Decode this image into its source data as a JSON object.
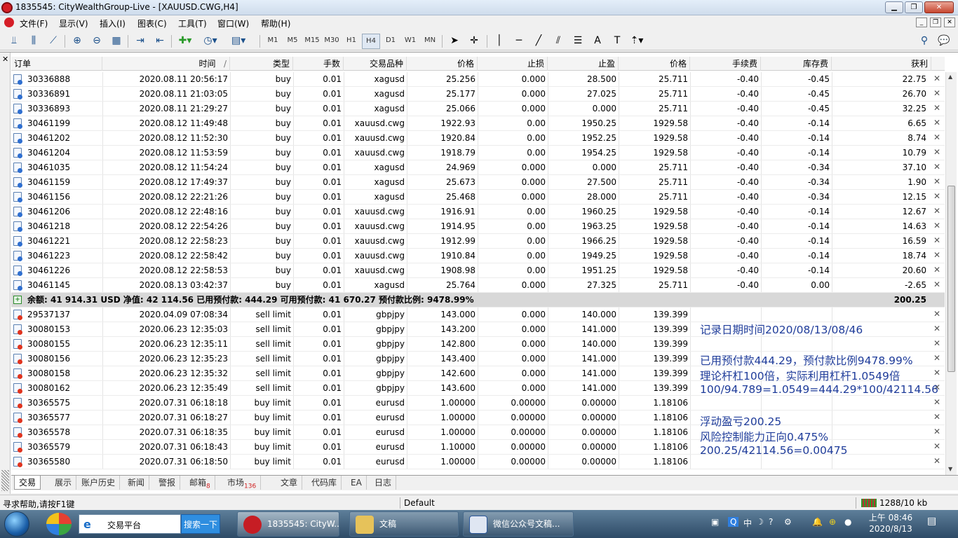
{
  "window": {
    "title": "1835545: CityWealthGroup-Live - [XAUUSD.CWG,H4]"
  },
  "menu": [
    "文件(F)",
    "显示(V)",
    "插入(I)",
    "图表(C)",
    "工具(T)",
    "窗口(W)",
    "帮助(H)"
  ],
  "timeframes": [
    {
      "label": "M1",
      "active": false
    },
    {
      "label": "M5",
      "active": false
    },
    {
      "label": "M15",
      "active": false
    },
    {
      "label": "M30",
      "active": false
    },
    {
      "label": "H1",
      "active": false
    },
    {
      "label": "H4",
      "active": true
    },
    {
      "label": "D1",
      "active": false
    },
    {
      "label": "W1",
      "active": false
    },
    {
      "label": "MN",
      "active": false
    }
  ],
  "columns": {
    "order": "订单",
    "time": "时间",
    "type": "类型",
    "lots": "手数",
    "symbol": "交易品种",
    "price": "价格",
    "sl": "止损",
    "tp": "止盈",
    "cur_price": "价格",
    "commission": "手续费",
    "swap": "库存费",
    "profit": "获利",
    "sort_marker": "/"
  },
  "open_positions": [
    [
      "30336888",
      "2020.08.11 20:56:17",
      "buy",
      "0.01",
      "xagusd",
      "25.256",
      "0.000",
      "28.500",
      "25.711",
      "-0.40",
      "-0.45",
      "22.75"
    ],
    [
      "30336891",
      "2020.08.11 21:03:05",
      "buy",
      "0.01",
      "xagusd",
      "25.177",
      "0.000",
      "27.025",
      "25.711",
      "-0.40",
      "-0.45",
      "26.70"
    ],
    [
      "30336893",
      "2020.08.11 21:29:27",
      "buy",
      "0.01",
      "xagusd",
      "25.066",
      "0.000",
      "0.000",
      "25.711",
      "-0.40",
      "-0.45",
      "32.25"
    ],
    [
      "30461199",
      "2020.08.12 11:49:48",
      "buy",
      "0.01",
      "xauusd.cwg",
      "1922.93",
      "0.00",
      "1950.25",
      "1929.58",
      "-0.40",
      "-0.14",
      "6.65"
    ],
    [
      "30461202",
      "2020.08.12 11:52:30",
      "buy",
      "0.01",
      "xauusd.cwg",
      "1920.84",
      "0.00",
      "1952.25",
      "1929.58",
      "-0.40",
      "-0.14",
      "8.74"
    ],
    [
      "30461204",
      "2020.08.12 11:53:59",
      "buy",
      "0.01",
      "xauusd.cwg",
      "1918.79",
      "0.00",
      "1954.25",
      "1929.58",
      "-0.40",
      "-0.14",
      "10.79"
    ],
    [
      "30461035",
      "2020.08.12 11:54:24",
      "buy",
      "0.01",
      "xagusd",
      "24.969",
      "0.000",
      "0.000",
      "25.711",
      "-0.40",
      "-0.34",
      "37.10"
    ],
    [
      "30461159",
      "2020.08.12 17:49:37",
      "buy",
      "0.01",
      "xagusd",
      "25.673",
      "0.000",
      "27.500",
      "25.711",
      "-0.40",
      "-0.34",
      "1.90"
    ],
    [
      "30461156",
      "2020.08.12 22:21:26",
      "buy",
      "0.01",
      "xagusd",
      "25.468",
      "0.000",
      "28.000",
      "25.711",
      "-0.40",
      "-0.34",
      "12.15"
    ],
    [
      "30461206",
      "2020.08.12 22:48:16",
      "buy",
      "0.01",
      "xauusd.cwg",
      "1916.91",
      "0.00",
      "1960.25",
      "1929.58",
      "-0.40",
      "-0.14",
      "12.67"
    ],
    [
      "30461218",
      "2020.08.12 22:54:26",
      "buy",
      "0.01",
      "xauusd.cwg",
      "1914.95",
      "0.00",
      "1963.25",
      "1929.58",
      "-0.40",
      "-0.14",
      "14.63"
    ],
    [
      "30461221",
      "2020.08.12 22:58:23",
      "buy",
      "0.01",
      "xauusd.cwg",
      "1912.99",
      "0.00",
      "1966.25",
      "1929.58",
      "-0.40",
      "-0.14",
      "16.59"
    ],
    [
      "30461223",
      "2020.08.12 22:58:42",
      "buy",
      "0.01",
      "xauusd.cwg",
      "1910.84",
      "0.00",
      "1949.25",
      "1929.58",
      "-0.40",
      "-0.14",
      "18.74"
    ],
    [
      "30461226",
      "2020.08.12 22:58:53",
      "buy",
      "0.01",
      "xauusd.cwg",
      "1908.98",
      "0.00",
      "1951.25",
      "1929.58",
      "-0.40",
      "-0.14",
      "20.60"
    ],
    [
      "30461145",
      "2020.08.13 03:42:37",
      "buy",
      "0.01",
      "xagusd",
      "25.764",
      "0.000",
      "27.325",
      "25.711",
      "-0.40",
      "0.00",
      "-2.65"
    ]
  ],
  "summary": {
    "text": "余额: 41 914.31 USD  净值: 42 114.56  已用预付款: 444.29  可用预付款: 41 670.27  预付款比例: 9478.99%",
    "profit": "200.25"
  },
  "pending_orders": [
    [
      "29537137",
      "2020.04.09 07:08:34",
      "sell limit",
      "0.01",
      "gbpjpy",
      "143.000",
      "0.000",
      "140.000",
      "139.399"
    ],
    [
      "30080153",
      "2020.06.23 12:35:03",
      "sell limit",
      "0.01",
      "gbpjpy",
      "143.200",
      "0.000",
      "141.000",
      "139.399"
    ],
    [
      "30080155",
      "2020.06.23 12:35:11",
      "sell limit",
      "0.01",
      "gbpjpy",
      "142.800",
      "0.000",
      "140.000",
      "139.399"
    ],
    [
      "30080156",
      "2020.06.23 12:35:23",
      "sell limit",
      "0.01",
      "gbpjpy",
      "143.400",
      "0.000",
      "141.000",
      "139.399"
    ],
    [
      "30080158",
      "2020.06.23 12:35:32",
      "sell limit",
      "0.01",
      "gbpjpy",
      "142.600",
      "0.000",
      "141.000",
      "139.399"
    ],
    [
      "30080162",
      "2020.06.23 12:35:49",
      "sell limit",
      "0.01",
      "gbpjpy",
      "143.600",
      "0.000",
      "141.000",
      "139.399"
    ],
    [
      "30365575",
      "2020.07.31 06:18:18",
      "buy limit",
      "0.01",
      "eurusd",
      "1.00000",
      "0.00000",
      "0.00000",
      "1.18106"
    ],
    [
      "30365577",
      "2020.07.31 06:18:27",
      "buy limit",
      "0.01",
      "eurusd",
      "1.00000",
      "0.00000",
      "0.00000",
      "1.18106"
    ],
    [
      "30365578",
      "2020.07.31 06:18:35",
      "buy limit",
      "0.01",
      "eurusd",
      "1.00000",
      "0.00000",
      "0.00000",
      "1.18106"
    ],
    [
      "30365579",
      "2020.07.31 06:18:43",
      "buy limit",
      "0.01",
      "eurusd",
      "1.10000",
      "0.00000",
      "0.00000",
      "1.18106"
    ],
    [
      "30365580",
      "2020.07.31 06:18:50",
      "buy limit",
      "0.01",
      "eurusd",
      "1.00000",
      "0.00000",
      "0.00000",
      "1.18106"
    ]
  ],
  "annotations": {
    "line1": "记录日期时间2020/08/13/08/46",
    "line2": "已用预付款444.29，预付款比例9478.99%",
    "line3": "理论杆杠100倍，实际利用杠杆1.0549倍",
    "line4": "100/94.789=1.0549=444.29*100/42114.56",
    "line5": "浮动盈亏200.25",
    "line6": "风险控制能力正向0.475%",
    "line7": "200.25/42114.56=0.00475"
  },
  "tabs": [
    {
      "label": "交易",
      "badge": ""
    },
    {
      "label": "展示",
      "badge": ""
    },
    {
      "label": "账户历史",
      "badge": ""
    },
    {
      "label": "新闻",
      "badge": ""
    },
    {
      "label": "警报",
      "badge": ""
    },
    {
      "label": "邮箱",
      "badge": "8"
    },
    {
      "label": "市场",
      "badge": "136"
    },
    {
      "label": "文章",
      "badge": ""
    },
    {
      "label": "代码库",
      "badge": ""
    },
    {
      "label": "EA",
      "badge": ""
    },
    {
      "label": "日志",
      "badge": ""
    }
  ],
  "status": {
    "help": "寻求帮助,请按F1键",
    "profile": "Default",
    "traffic": "1288/10 kb"
  },
  "taskbar": {
    "address": "交易平台",
    "search": "搜索一下",
    "items": [
      "1835545: CityW...",
      "文稿",
      "微信公众号文稿..."
    ],
    "ime": "中",
    "clock_time": "上午 08:46",
    "clock_date": "2020/8/13"
  }
}
